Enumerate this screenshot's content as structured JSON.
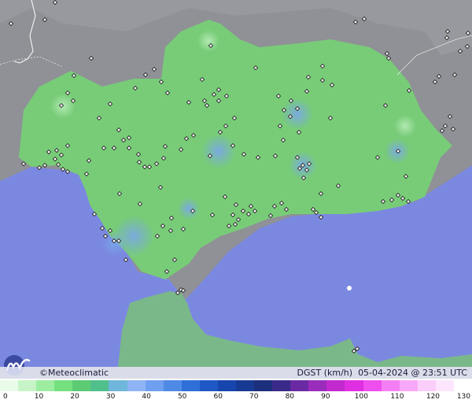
{
  "brand": "©Meteoclimatic",
  "product": "DGST (km/h)",
  "timestamp": "05-04-2024 @ 23:51 UTC",
  "scale": {
    "ticks": [
      "0",
      "10",
      "20",
      "30",
      "40",
      "50",
      "60",
      "70",
      "80",
      "90",
      "100",
      "110",
      "120",
      "130"
    ],
    "colors": [
      "#e9fbe9",
      "#c6f4c6",
      "#9ceda0",
      "#74e07e",
      "#5ccb74",
      "#4fbf8c",
      "#6fb6dc",
      "#8fb4f4",
      "#6f9ff0",
      "#4f8ae6",
      "#2f6fd8",
      "#1f58c4",
      "#1646ae",
      "#173a93",
      "#1c2f7c",
      "#3a2a8a",
      "#6a2aa4",
      "#9a2cbc",
      "#c22ad0",
      "#e02ee2",
      "#ee4fee",
      "#f47ff4",
      "#f8a8f8",
      "#fbcdfb",
      "#fde6fd",
      "#ffffff"
    ]
  },
  "colors": {
    "sea": "#7b88e0",
    "land_outside": "#8f9196",
    "andalusia": "#78cc78",
    "morocco": "#7ab88a"
  },
  "icons": [
    "meteoclimatic-logo-icon",
    "station-marker-icon"
  ]
}
